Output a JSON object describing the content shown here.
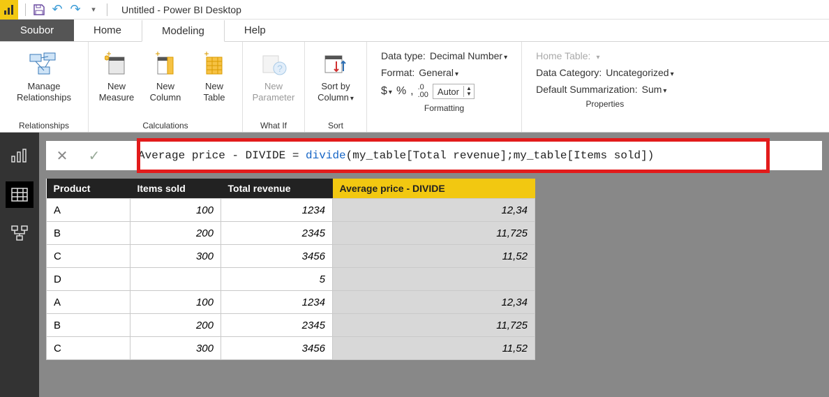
{
  "title": "Untitled - Power BI Desktop",
  "menu": {
    "file": "Soubor",
    "tabs": [
      "Home",
      "Modeling",
      "Help"
    ],
    "active": 1
  },
  "ribbon": {
    "relationships": {
      "label": "Relationships",
      "btn": "Manage\nRelationships"
    },
    "calculations": {
      "label": "Calculations",
      "measure": "New\nMeasure",
      "column": "New\nColumn",
      "table": "New\nTable"
    },
    "whatif": {
      "label": "What If",
      "param": "New\nParameter"
    },
    "sort": {
      "label": "Sort",
      "btn": "Sort by\nColumn"
    },
    "formatting": {
      "label": "Formatting",
      "datatype_lbl": "Data type:",
      "datatype_val": "Decimal Number",
      "format_lbl": "Format:",
      "format_val": "General",
      "currency": "$",
      "percent": "%",
      "thousands": ",",
      "decimals_icon": ".00",
      "decimals_val": "Autor"
    },
    "properties": {
      "label": "Properties",
      "hometable_lbl": "Home Table:",
      "hometable_val": "",
      "category_lbl": "Data Category:",
      "category_val": "Uncategorized",
      "summarization_lbl": "Default Summarization:",
      "summarization_val": "Sum"
    }
  },
  "formula": {
    "prefix": "Average price - DIVIDE = ",
    "func": "divide",
    "args": "(my_table[Total revenue];my_table[Items sold])"
  },
  "table": {
    "columns": [
      "Product",
      "Items sold",
      "Total revenue",
      "Average price - DIVIDE"
    ],
    "rows": [
      {
        "product": "A",
        "items": "100",
        "rev": "1234",
        "avg": "12,34"
      },
      {
        "product": "B",
        "items": "200",
        "rev": "2345",
        "avg": "11,725"
      },
      {
        "product": "C",
        "items": "300",
        "rev": "3456",
        "avg": "11,52"
      },
      {
        "product": "D",
        "items": "",
        "rev": "5",
        "avg": ""
      },
      {
        "product": "A",
        "items": "100",
        "rev": "1234",
        "avg": "12,34"
      },
      {
        "product": "B",
        "items": "200",
        "rev": "2345",
        "avg": "11,725"
      },
      {
        "product": "C",
        "items": "300",
        "rev": "3456",
        "avg": "11,52"
      }
    ]
  }
}
